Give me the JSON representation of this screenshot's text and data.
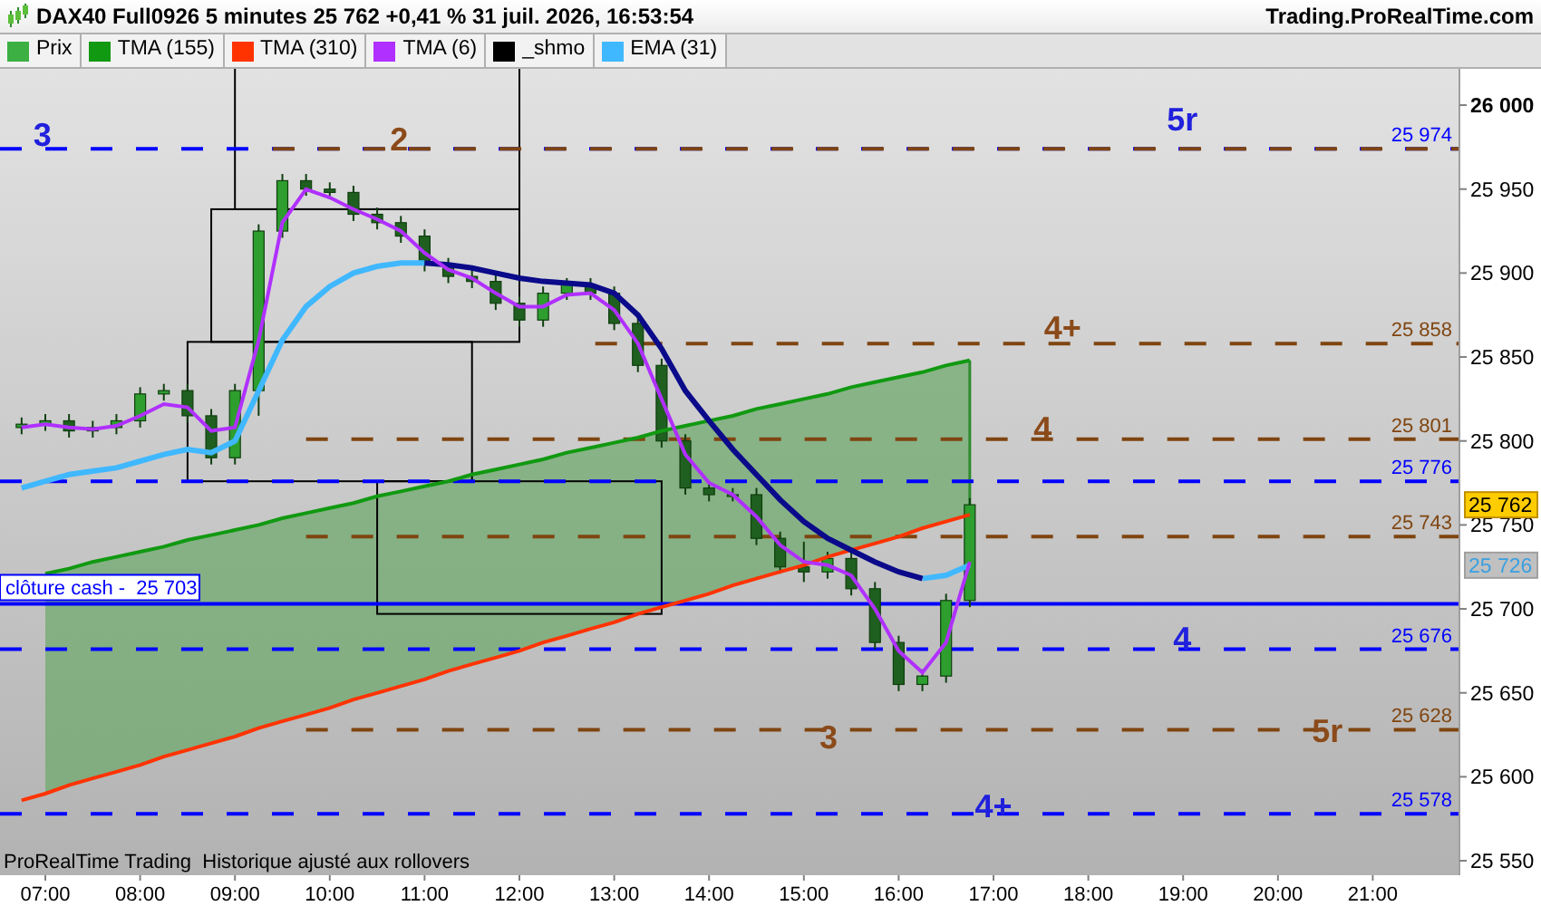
{
  "header": {
    "title": "DAX40 Full0926 5 minutes 25 762 +0,41 % 31 juil. 2026, 16:53:54",
    "site": "Trading.ProRealTime.com"
  },
  "legend": [
    {
      "label": "Prix",
      "color": "#3cb043"
    },
    {
      "label": "_shmo",
      "color": "#000000"
    }
  ],
  "chart": {
    "chart_data": {
      "type": "candlestick",
      "x": [
        6.75,
        7,
        7.25,
        7.5,
        7.75,
        8,
        8.25,
        8.5,
        8.75,
        9,
        9.25,
        9.5,
        9.75,
        10,
        10.25,
        10.5,
        10.75,
        11,
        11.25,
        11.5,
        11.75,
        12,
        12.25,
        12.5,
        12.75,
        13,
        13.25,
        13.5,
        13.75,
        14,
        14.25,
        14.5,
        14.75,
        15,
        15.25,
        15.5,
        15.75,
        16,
        16.25,
        16.5,
        16.75
      ],
      "ohlc": [
        [
          25808,
          25814,
          25804,
          25810
        ],
        [
          25810,
          25816,
          25806,
          25812
        ],
        [
          25812,
          25816,
          25802,
          25806
        ],
        [
          25806,
          25812,
          25802,
          25808
        ],
        [
          25808,
          25816,
          25804,
          25812
        ],
        [
          25812,
          25832,
          25808,
          25828
        ],
        [
          25828,
          25834,
          25824,
          25830
        ],
        [
          25830,
          25834,
          25811,
          25815
        ],
        [
          25815,
          25819,
          25786,
          25790
        ],
        [
          25790,
          25834,
          25786,
          25830
        ],
        [
          25830,
          25929,
          25815,
          25925
        ],
        [
          25925,
          25959,
          25921,
          25955
        ],
        [
          25955,
          25959,
          25946,
          25950
        ],
        [
          25950,
          25954,
          25944,
          25948
        ],
        [
          25948,
          25952,
          25931,
          25935
        ],
        [
          25935,
          25939,
          25926,
          25930
        ],
        [
          25930,
          25934,
          25918,
          25922
        ],
        [
          25922,
          25926,
          25901,
          25905
        ],
        [
          25905,
          25909,
          25894,
          25898
        ],
        [
          25898,
          25902,
          25891,
          25895
        ],
        [
          25895,
          25899,
          25878,
          25882
        ],
        [
          25882,
          25886,
          25868,
          25872
        ],
        [
          25872,
          25892,
          25868,
          25888
        ],
        [
          25888,
          25897,
          25884,
          25893
        ],
        [
          25893,
          25897,
          25884,
          25888
        ],
        [
          25888,
          25892,
          25866,
          25870
        ],
        [
          25870,
          25874,
          25841,
          25845
        ],
        [
          25845,
          25849,
          25796,
          25800
        ],
        [
          25800,
          25804,
          25768,
          25772
        ],
        [
          25772,
          25776,
          25764,
          25768
        ],
        [
          25768,
          25772,
          25764,
          25768
        ],
        [
          25768,
          25772,
          25738,
          25742
        ],
        [
          25742,
          25746,
          25721,
          25725
        ],
        [
          25725,
          25740,
          25716,
          25722
        ],
        [
          25722,
          25734,
          25718,
          25730
        ],
        [
          25730,
          25734,
          25708,
          25712
        ],
        [
          25712,
          25716,
          25676,
          25680
        ],
        [
          25680,
          25684,
          25651,
          25655
        ],
        [
          25655,
          25664,
          25651,
          25660
        ],
        [
          25660,
          25709,
          25656,
          25705
        ],
        [
          25705,
          25766,
          25701,
          25762
        ]
      ],
      "series": [
        {
          "name": "TMA (155)",
          "type": "line",
          "color": "#119911",
          "values": [
            null,
            25721,
            25724,
            25728,
            25731,
            25734,
            25737,
            25741,
            25744,
            25747,
            25750,
            25754,
            25757,
            25760,
            25763,
            25767,
            25770,
            25773,
            25776,
            25780,
            25783,
            25786,
            25789,
            25793,
            25796,
            25799,
            25802,
            25806,
            25809,
            25812,
            25815,
            25819,
            25822,
            25825,
            25828,
            25832,
            25835,
            25838,
            25841,
            25845,
            25848
          ]
        },
        {
          "name": "TMA (310)",
          "type": "line",
          "color": "#ff3300",
          "values": [
            25586,
            25590,
            25595,
            25599,
            25603,
            25607,
            25612,
            25616,
            25620,
            25624,
            25629,
            25633,
            25637,
            25641,
            25646,
            25650,
            25654,
            25658,
            25663,
            25667,
            25671,
            25675,
            25680,
            25684,
            25688,
            25692,
            25697,
            25701,
            25705,
            25709,
            25714,
            25718,
            25722,
            25726,
            25731,
            25735,
            25739,
            25743,
            25748,
            25752,
            25756
          ]
        },
        {
          "name": "TMA (6)",
          "type": "line",
          "color": "#b030ff",
          "values": [
            25808,
            25810,
            25808,
            25807,
            25809,
            25815,
            25822,
            25820,
            25806,
            25808,
            25860,
            25930,
            25950,
            25945,
            25938,
            25932,
            25925,
            25912,
            25902,
            25897,
            25888,
            25880,
            25880,
            25887,
            25888,
            25878,
            25858,
            25825,
            25792,
            25775,
            25768,
            25755,
            25738,
            25728,
            25726,
            25720,
            25700,
            25675,
            25662,
            25680,
            25728
          ]
        },
        {
          "name": "EMA (31)",
          "type": "line",
          "color": "#40b8ff",
          "values": [
            25772,
            25776,
            25780,
            25782,
            25784,
            25788,
            25792,
            25795,
            25793,
            25800,
            25830,
            25860,
            25880,
            25892,
            25900,
            25904,
            25906,
            25906,
            null,
            null,
            null,
            null,
            null,
            null,
            null,
            null,
            null,
            null,
            null,
            null,
            null,
            null,
            null,
            null,
            null,
            null,
            null,
            null,
            25718,
            25720,
            25726
          ]
        },
        {
          "type": "line",
          "color": "#0a0a8a",
          "values": [
            null,
            null,
            null,
            null,
            null,
            null,
            null,
            null,
            null,
            null,
            null,
            null,
            null,
            null,
            null,
            null,
            null,
            25906,
            25905,
            25903,
            25900,
            25897,
            25895,
            25894,
            25893,
            25888,
            25875,
            25855,
            25830,
            25812,
            25795,
            25780,
            25765,
            25752,
            25742,
            25735,
            25728,
            25722,
            25718,
            null,
            null
          ]
        }
      ],
      "xlim": [
        6.522,
        21.914
      ],
      "ylim": [
        25541.4,
        26021.6
      ],
      "xticks": [
        {
          "value": 7,
          "label": "07:00"
        },
        {
          "value": 8,
          "label": "08:00"
        },
        {
          "value": 9,
          "label": "09:00"
        },
        {
          "value": 10,
          "label": "10:00"
        },
        {
          "value": 11,
          "label": "11:00"
        },
        {
          "value": 12,
          "label": "12:00"
        },
        {
          "value": 13,
          "label": "13:00"
        },
        {
          "value": 14,
          "label": "14:00"
        },
        {
          "value": 15,
          "label": "15:00"
        },
        {
          "value": 16,
          "label": "16:00"
        },
        {
          "value": 17,
          "label": "17:00"
        },
        {
          "value": 18,
          "label": "18:00"
        },
        {
          "value": 19,
          "label": "19:00"
        },
        {
          "value": 20,
          "label": "20:00"
        },
        {
          "value": 21,
          "label": "21:00"
        }
      ],
      "yticks": [
        {
          "value": 26000,
          "label": "26 000"
        },
        {
          "value": 25950,
          "label": "25 950"
        },
        {
          "value": 25900,
          "label": "25 900"
        },
        {
          "value": 25850,
          "label": "25 850"
        },
        {
          "value": 25800,
          "label": "25 800"
        },
        {
          "value": 25750,
          "label": "25 750"
        },
        {
          "value": 25700,
          "label": "25 700"
        },
        {
          "value": 25650,
          "label": "25 650"
        },
        {
          "value": 25600,
          "label": "25 600"
        },
        {
          "value": 25550,
          "label": "25 550"
        }
      ],
      "ref_lines": [
        {
          "axis": "y",
          "value": 25974,
          "color": "#0000ff",
          "label": "25 974"
        },
        {
          "axis": "y",
          "value": 25974,
          "color": "#7f4510"
        },
        {
          "axis": "y",
          "value": 25858,
          "color": "#7f4510",
          "label": "25 858"
        },
        {
          "axis": "y",
          "value": 25801,
          "color": "#7f4510",
          "label": "25 801"
        },
        {
          "axis": "y",
          "value": 25776,
          "color": "#0000ff",
          "label": "25 776"
        },
        {
          "axis": "y",
          "value": 25743,
          "color": "#7f4510",
          "label": "25 743"
        },
        {
          "axis": "y",
          "value": 25703,
          "color": "#0000ff",
          "label": "clôture cash -  25 703"
        },
        {
          "axis": "y",
          "value": 25676,
          "color": "#0000ff",
          "label": "25 676"
        },
        {
          "axis": "y",
          "value": 25628,
          "color": "#7f4510",
          "label": "25 628"
        },
        {
          "axis": "y",
          "value": 25578,
          "color": "#0000ff",
          "label": "25 578"
        }
      ],
      "annotations": [
        "3",
        "2",
        "5r",
        "4+",
        "4",
        "4",
        "3",
        "5r",
        "4+"
      ]
    },
    "price_tags": [
      {
        "text": "25 762",
        "kind": "last"
      },
      {
        "text": "25 726",
        "kind": "indicator"
      }
    ],
    "footnote": "ProRealTime Trading  Historique ajusté aux rollovers"
  }
}
